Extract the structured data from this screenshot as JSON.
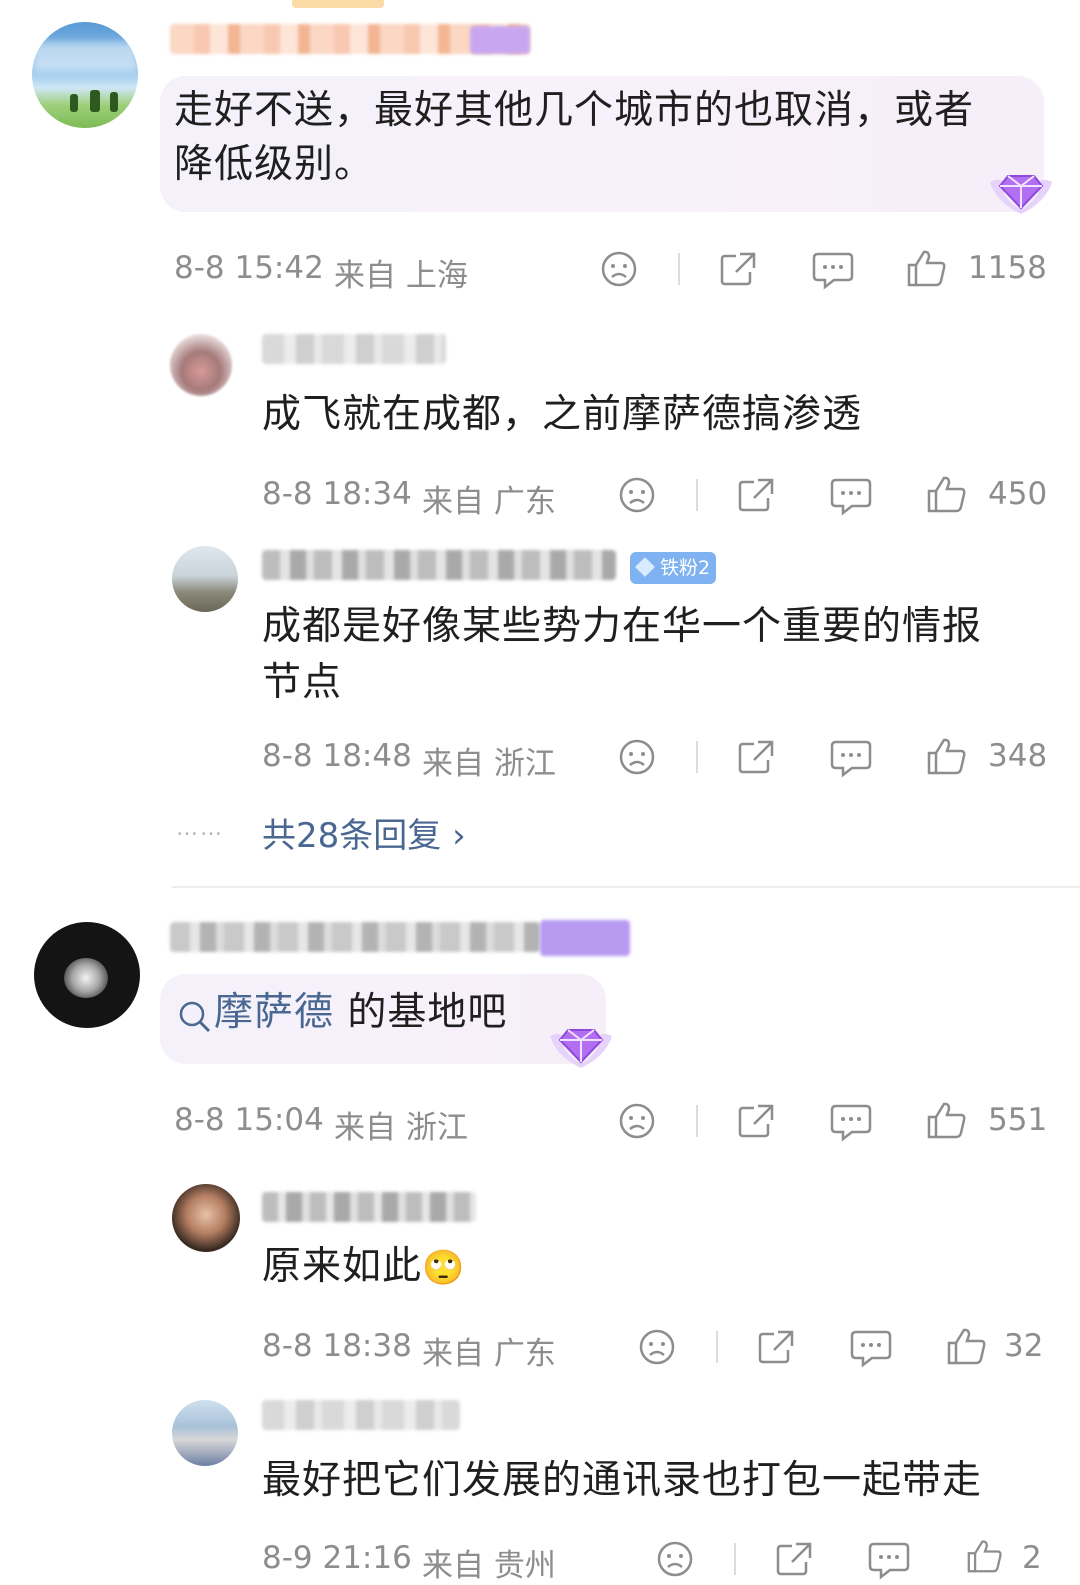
{
  "colors": {
    "link": "#4a6791",
    "meta": "#8d8d8d",
    "text": "#1f1f1f",
    "bubble": "#f4f1fb"
  },
  "comments": [
    {
      "text_line1": "走好不送，最好其他几个城市的也取消，或者",
      "text_line2": "降低级别。",
      "time": "8-8 15:42",
      "location": "来自 上海",
      "likes": "1158"
    },
    {
      "reply1": {
        "text": "成飞就在成都，之前摩萨德搞渗透",
        "time": "8-8 18:34",
        "location": "来自 广东",
        "likes": "450"
      },
      "reply2": {
        "badge": "铁粉2",
        "text_line1": "成都是好像某些势力在华一个重要的情报",
        "text_line2": "节点",
        "time": "8-8 18:48",
        "location": "来自 浙江",
        "likes": "348"
      },
      "more_dots": "……",
      "more_replies": "共28条回复 ›"
    },
    {
      "search_term": "摩萨德",
      "text_rest": " 的基地吧",
      "time": "8-8 15:04",
      "location": "来自 浙江",
      "likes": "551"
    },
    {
      "reply1": {
        "text": "原来如此",
        "emoji": "🙄",
        "time": "8-8 18:38",
        "location": "来自 广东",
        "likes": "32"
      },
      "reply2": {
        "text": "最好把它们发展的通讯录也打包一起带走",
        "time": "8-9 21:16",
        "location": "来自 贵州",
        "likes": "2"
      }
    }
  ],
  "icons": [
    "sad-face-icon",
    "share-icon",
    "comment-icon",
    "thumbs-up-icon",
    "search-icon",
    "diamond-badge-icon"
  ]
}
